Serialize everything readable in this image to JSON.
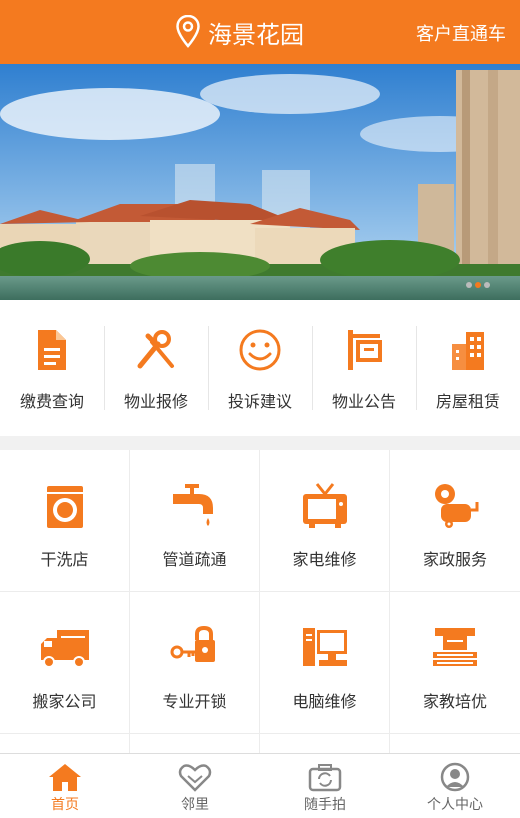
{
  "header": {
    "title": "海景花园",
    "right_link": "客户直通车"
  },
  "colors": {
    "accent": "#f47a1f",
    "text": "#333333",
    "inactive": "#888888"
  },
  "quick_actions": [
    {
      "label": "缴费查询",
      "icon": "document-icon"
    },
    {
      "label": "物业报修",
      "icon": "tools-icon"
    },
    {
      "label": "投诉建议",
      "icon": "smiley-icon"
    },
    {
      "label": "物业公告",
      "icon": "signboard-icon"
    },
    {
      "label": "房屋租赁",
      "icon": "building-icon"
    }
  ],
  "services": [
    {
      "label": "干洗店",
      "icon": "washing-machine-icon"
    },
    {
      "label": "管道疏通",
      "icon": "faucet-icon"
    },
    {
      "label": "家电维修",
      "icon": "tv-icon"
    },
    {
      "label": "家政服务",
      "icon": "vacuum-icon"
    },
    {
      "label": "搬家公司",
      "icon": "truck-icon"
    },
    {
      "label": "专业开锁",
      "icon": "key-lock-icon"
    },
    {
      "label": "电脑维修",
      "icon": "computer-icon"
    },
    {
      "label": "家教培优",
      "icon": "books-icon"
    }
  ],
  "tabs": [
    {
      "label": "首页",
      "icon": "home-icon",
      "active": true
    },
    {
      "label": "邻里",
      "icon": "handshake-icon",
      "active": false
    },
    {
      "label": "随手拍",
      "icon": "camera-icon",
      "active": false
    },
    {
      "label": "个人中心",
      "icon": "user-icon",
      "active": false
    }
  ]
}
